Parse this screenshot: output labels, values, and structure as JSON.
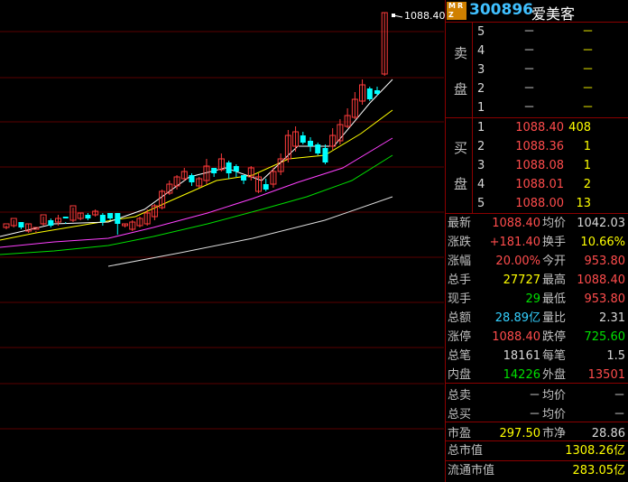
{
  "stock": {
    "code": "300896",
    "name": "爱美客",
    "logo_letters": [
      "M",
      "R",
      "Z"
    ]
  },
  "chart": {
    "high_marker": "1088.40",
    "ma_colors": {
      "ma5": "#ffffff",
      "ma10": "#ffff00",
      "ma20": "#ff40ff",
      "ma30": "#00e000",
      "ma60": "#dddddd"
    }
  },
  "orderbook": {
    "sell_label_1": "卖",
    "sell_label_2": "盘",
    "buy_label_1": "买",
    "buy_label_2": "盘",
    "sell": [
      {
        "lvl": "5",
        "price": "－",
        "vol": "－"
      },
      {
        "lvl": "4",
        "price": "－",
        "vol": "－"
      },
      {
        "lvl": "3",
        "price": "－",
        "vol": "－"
      },
      {
        "lvl": "2",
        "price": "－",
        "vol": "－"
      },
      {
        "lvl": "1",
        "price": "－",
        "vol": "－"
      }
    ],
    "buy": [
      {
        "lvl": "1",
        "price": "1088.40",
        "vol": "408"
      },
      {
        "lvl": "2",
        "price": "1088.36",
        "vol": "1"
      },
      {
        "lvl": "3",
        "price": "1088.08",
        "vol": "1"
      },
      {
        "lvl": "4",
        "price": "1088.01",
        "vol": "2"
      },
      {
        "lvl": "5",
        "price": "1088.00",
        "vol": "13"
      }
    ]
  },
  "stats": {
    "latest": {
      "l": "最新",
      "v": "1088.40",
      "l2": "均价",
      "v2": "1042.03"
    },
    "change": {
      "l": "涨跌",
      "v": "+181.40",
      "l2": "换手",
      "v2": "10.66%"
    },
    "pct": {
      "l": "涨幅",
      "v": "20.00%",
      "l2": "今开",
      "v2": "953.80"
    },
    "total": {
      "l": "总手",
      "v": "27727",
      "l2": "最高",
      "v2": "1088.40"
    },
    "now": {
      "l": "现手",
      "v": "29",
      "l2": "最低",
      "v2": "953.80"
    },
    "amount": {
      "l": "总额",
      "v": "28.89亿",
      "l2": "量比",
      "v2": "2.31"
    },
    "limit": {
      "l": "涨停",
      "v": "1088.40",
      "l2": "跌停",
      "v2": "725.60"
    },
    "trades": {
      "l": "总笔",
      "v": "18161",
      "l2": "每笔",
      "v2": "1.5"
    },
    "inner": {
      "l": "内盘",
      "v": "14226",
      "l2": "外盘",
      "v2": "13501"
    }
  },
  "extra": {
    "sell_total": {
      "l": "总卖",
      "v": "－",
      "l2": "均价",
      "v2": "－"
    },
    "buy_total": {
      "l": "总买",
      "v": "－",
      "l2": "均价",
      "v2": "－"
    },
    "pe": {
      "l": "市盈",
      "v": "297.50",
      "l2": "市净",
      "v2": "28.86"
    },
    "mcap": {
      "l": "总市值",
      "v": "1308.26亿"
    },
    "float_mcap": {
      "l": "流通市值",
      "v": "283.05亿"
    }
  },
  "candles": [
    [
      248,
      252,
      250,
      254,
      "u"
    ],
    [
      242,
      250,
      244,
      252,
      "u"
    ],
    [
      246,
      252,
      246,
      254,
      "d"
    ],
    [
      248,
      256,
      248,
      258,
      "u"
    ],
    [
      254,
      252,
      256,
      258,
      "u"
    ],
    [
      238,
      248,
      240,
      250,
      "u"
    ],
    [
      244,
      250,
      242,
      252,
      "d"
    ],
    [
      242,
      246,
      238,
      250,
      "u"
    ],
    [
      242,
      240,
      246,
      248,
      "d"
    ],
    [
      228,
      244,
      230,
      246,
      "u"
    ],
    [
      236,
      242,
      236,
      244,
      "u"
    ],
    [
      238,
      242,
      236,
      244,
      "d"
    ],
    [
      234,
      238,
      232,
      240,
      "u"
    ],
    [
      238,
      246,
      236,
      250,
      "d"
    ],
    [
      236,
      242,
      236,
      244,
      "d"
    ],
    [
      236,
      248,
      244,
      260,
      "d"
    ],
    [
      248,
      250,
      248,
      252,
      "u"
    ],
    [
      246,
      254,
      244,
      256,
      "u"
    ],
    [
      242,
      250,
      240,
      252,
      "u"
    ],
    [
      236,
      248,
      232,
      250,
      "u"
    ],
    [
      228,
      240,
      226,
      244,
      "u"
    ],
    [
      212,
      230,
      210,
      232,
      "u"
    ],
    [
      204,
      214,
      200,
      216,
      "u"
    ],
    [
      196,
      206,
      194,
      210,
      "u"
    ],
    [
      190,
      198,
      186,
      200,
      "u"
    ],
    [
      194,
      202,
      192,
      206,
      "d"
    ],
    [
      198,
      206,
      196,
      208,
      "u"
    ],
    [
      184,
      200,
      176,
      204,
      "u"
    ],
    [
      186,
      192,
      186,
      196,
      "d"
    ],
    [
      176,
      188,
      170,
      190,
      "u"
    ],
    [
      180,
      192,
      178,
      198,
      "d"
    ],
    [
      184,
      190,
      182,
      196,
      "d"
    ],
    [
      194,
      200,
      194,
      204,
      "d"
    ],
    [
      186,
      196,
      184,
      200,
      "u"
    ],
    [
      196,
      212,
      192,
      214,
      "u"
    ],
    [
      204,
      210,
      198,
      212,
      "d"
    ],
    [
      190,
      204,
      186,
      208,
      "u"
    ],
    [
      176,
      190,
      170,
      194,
      "u"
    ],
    [
      150,
      176,
      144,
      180,
      "u"
    ],
    [
      146,
      162,
      140,
      168,
      "u"
    ],
    [
      150,
      158,
      146,
      160,
      "d"
    ],
    [
      156,
      162,
      152,
      168,
      "d"
    ],
    [
      160,
      170,
      158,
      172,
      "d"
    ],
    [
      164,
      180,
      160,
      182,
      "d"
    ],
    [
      150,
      162,
      142,
      166,
      "u"
    ],
    [
      138,
      156,
      132,
      160,
      "u"
    ],
    [
      128,
      140,
      120,
      142,
      "u"
    ],
    [
      110,
      130,
      102,
      132,
      "u"
    ],
    [
      94,
      112,
      88,
      116,
      "u"
    ],
    [
      98,
      110,
      96,
      112,
      "d"
    ],
    [
      100,
      104,
      96,
      106,
      "d"
    ],
    [
      14,
      82,
      14,
      84,
      "u"
    ]
  ]
}
